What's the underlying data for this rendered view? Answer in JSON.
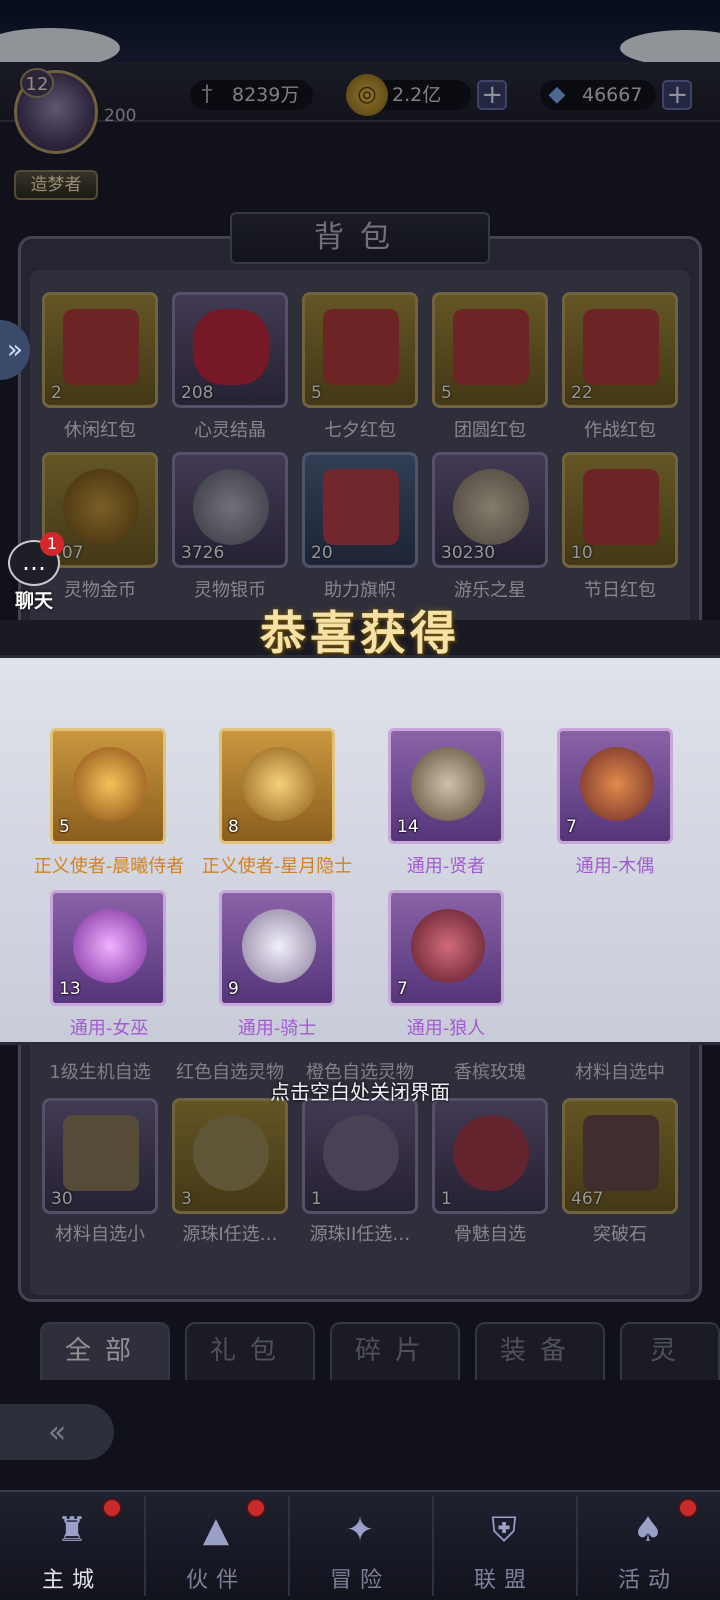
{
  "player": {
    "level": "12",
    "title": "造梦者",
    "sub_value": "200"
  },
  "resources": [
    {
      "icon": "sword-icon",
      "value": "8239万",
      "has_plus": false
    },
    {
      "icon": "gold-coin-icon",
      "value": "2.2亿",
      "has_plus": true
    },
    {
      "icon": "diamond-icon",
      "value": "46667",
      "has_plus": true
    }
  ],
  "plus_label": "+",
  "bag": {
    "title": "背包",
    "items": [
      {
        "label": "休闲红包",
        "count": "2",
        "style": "gold",
        "art": "#b03a3a"
      },
      {
        "label": "心灵结晶",
        "count": "208",
        "style": "purple",
        "art": "#c0283e"
      },
      {
        "label": "七夕红包",
        "count": "5",
        "style": "gold",
        "art": "#b03a3a"
      },
      {
        "label": "团圆红包",
        "count": "5",
        "style": "gold",
        "art": "#b03a3a"
      },
      {
        "label": "作战红包",
        "count": "22",
        "style": "gold",
        "art": "#b03a3a"
      },
      {
        "label": "灵物金币",
        "count": "207",
        "style": "gold",
        "art": "#8a6a2a"
      },
      {
        "label": "灵物银币",
        "count": "3726",
        "style": "purple",
        "art": "#8a8a9a"
      },
      {
        "label": "助力旗帜",
        "count": "20",
        "style": "blue",
        "art": "#b84048"
      },
      {
        "label": "游乐之星",
        "count": "30230",
        "style": "purple",
        "art": "#a0948a"
      },
      {
        "label": "节日红包",
        "count": "10",
        "style": "gold",
        "art": "#b03a3a"
      }
    ],
    "bottom_items": [
      {
        "label": "材料自选小",
        "count": "30",
        "style": "purple",
        "art": "#8a7a5a"
      },
      {
        "label": "源珠I任选…",
        "count": "3",
        "style": "gold",
        "art": "#9a8a5a"
      },
      {
        "label": "源珠II任选…",
        "count": "1",
        "style": "purple",
        "art": "#7a6a8a"
      },
      {
        "label": "骨魅自选",
        "count": "1",
        "style": "purple",
        "art": "#a03a4a"
      },
      {
        "label": "突破石",
        "count": "467",
        "style": "gold",
        "art": "#6a4a4a"
      }
    ],
    "row_labels_partial": [
      "1级生机自选",
      "红色自选灵物",
      "橙色自选灵物",
      "香槟玫瑰",
      "材料自选中"
    ]
  },
  "chat": {
    "label": "聊天",
    "badge": "1",
    "icon": "chat-bubble-icon"
  },
  "congrats": {
    "title": "恭喜获得",
    "rewards": [
      {
        "label": "正义使者-晨曦侍者",
        "count": "5",
        "style": "orange",
        "art": "#c4862e"
      },
      {
        "label": "正义使者-星月隐士",
        "count": "8",
        "style": "orange",
        "art": "#c4862e"
      },
      {
        "label": "通用-贤者",
        "count": "14",
        "style": "purple",
        "art": "#9a8a7a"
      },
      {
        "label": "通用-木偶",
        "count": "7",
        "style": "purple",
        "art": "#b9603a"
      },
      {
        "label": "通用-女巫",
        "count": "13",
        "style": "purple",
        "art": "#c47ae6"
      },
      {
        "label": "通用-骑士",
        "count": "9",
        "style": "purple",
        "art": "#d6d6e6"
      },
      {
        "label": "通用-狼人",
        "count": "7",
        "style": "purple",
        "art": "#a03a4a"
      }
    ],
    "close_hint": "点击空白处关闭界面"
  },
  "tabs": [
    "全部",
    "礼包",
    "碎片",
    "装备",
    "灵"
  ],
  "nav": [
    {
      "label": "主城",
      "icon": "castle-icon",
      "dot": true,
      "active": true
    },
    {
      "label": "伙伴",
      "icon": "witch-hat-icon",
      "dot": true,
      "active": false
    },
    {
      "label": "冒险",
      "icon": "compass-icon",
      "dot": false,
      "active": false
    },
    {
      "label": "联盟",
      "icon": "shield-icon",
      "dot": false,
      "active": false
    },
    {
      "label": "活动",
      "icon": "cards-icon",
      "dot": true,
      "active": false
    }
  ],
  "colors": {
    "reward_orange": "#d7801c",
    "reward_purple": "#a45ad2",
    "badge_red": "#d3272b"
  }
}
